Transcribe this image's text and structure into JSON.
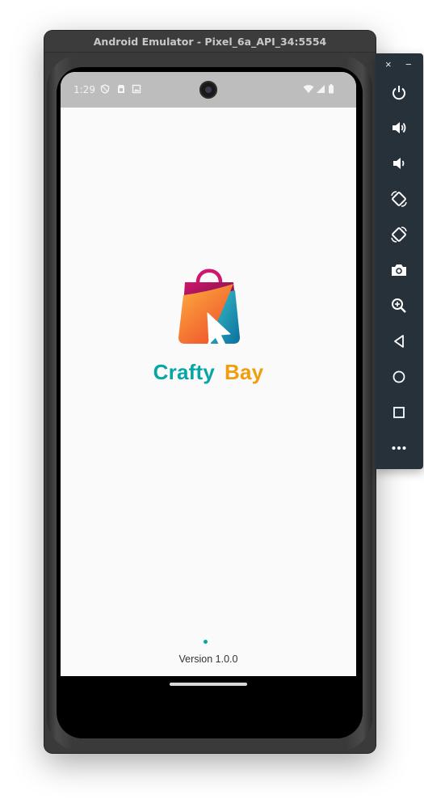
{
  "window": {
    "title": "Android Emulator - Pixel_6a_API_34:5554"
  },
  "status_bar": {
    "time": "1:29",
    "icons": [
      "shield-icon",
      "sim-card-icon",
      "photo-icon",
      "wifi-icon",
      "signal-icon",
      "battery-icon"
    ]
  },
  "app": {
    "brand_left": "Crafty",
    "brand_right": "Bay",
    "version": "Version 1.0.0",
    "colors": {
      "teal": "#07a6a6",
      "orange": "#f29d0e",
      "magenta": "#c4146e",
      "background": "#fafafa"
    }
  },
  "toolbar": {
    "close": "×",
    "minimize": "−",
    "buttons": [
      "power-icon",
      "volume-up-icon",
      "volume-down-icon",
      "rotate-left-icon",
      "rotate-right-icon",
      "camera-icon",
      "zoom-icon",
      "back-icon",
      "home-icon",
      "overview-icon",
      "more-icon"
    ]
  }
}
